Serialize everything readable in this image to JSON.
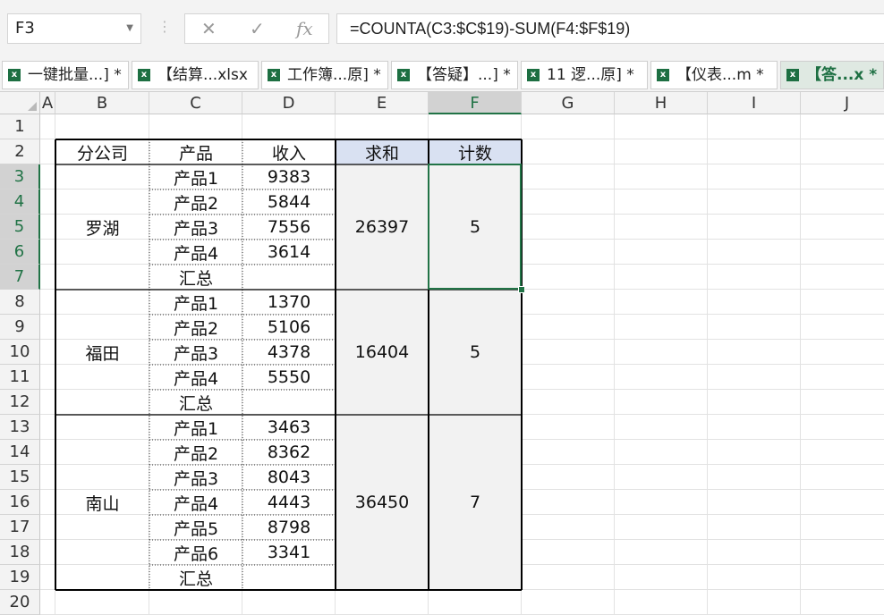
{
  "formula_bar": {
    "name_box": "F3",
    "formula": "=COUNTA(C3:$C$19)-SUM(F4:$F$19)",
    "cancel_icon": "✕",
    "enter_icon": "✓",
    "fx_icon": "fx"
  },
  "tabs": [
    {
      "label": "一键批量...] *"
    },
    {
      "label": "【结算...xlsx"
    },
    {
      "label": "工作簿...原] *"
    },
    {
      "label": "【答疑】...] *"
    },
    {
      "label": "11 逻...原] *"
    },
    {
      "label": "【仪表...m *"
    },
    {
      "label": "【答...x *"
    }
  ],
  "columns": [
    "A",
    "B",
    "C",
    "D",
    "E",
    "F",
    "G",
    "H",
    "I",
    "J"
  ],
  "rows": [
    "1",
    "2",
    "3",
    "4",
    "5",
    "6",
    "7",
    "8",
    "9",
    "10",
    "11",
    "12",
    "13",
    "14",
    "15",
    "16",
    "17",
    "18",
    "19",
    "20"
  ],
  "table": {
    "headers": {
      "branch": "分公司",
      "product": "产品",
      "income": "收入",
      "sum": "求和",
      "count": "计数"
    },
    "groups": [
      {
        "branch": "罗湖",
        "sum": "26397",
        "count": "5",
        "products": [
          "产品1",
          "产品2",
          "产品3",
          "产品4",
          "汇总"
        ],
        "incomes": [
          "9383",
          "5844",
          "7556",
          "3614",
          ""
        ]
      },
      {
        "branch": "福田",
        "sum": "16404",
        "count": "5",
        "products": [
          "产品1",
          "产品2",
          "产品3",
          "产品4",
          "汇总"
        ],
        "incomes": [
          "1370",
          "5106",
          "4378",
          "5550",
          ""
        ]
      },
      {
        "branch": "南山",
        "sum": "36450",
        "count": "7",
        "products": [
          "产品1",
          "产品2",
          "产品3",
          "产品4",
          "产品5",
          "产品6",
          "汇总"
        ],
        "incomes": [
          "3463",
          "8362",
          "8043",
          "4443",
          "8798",
          "3341",
          ""
        ]
      }
    ]
  },
  "colors": {
    "accent": "#217346",
    "header_fill": "#d9e1f2",
    "merged_fill": "#f2f2f2"
  }
}
